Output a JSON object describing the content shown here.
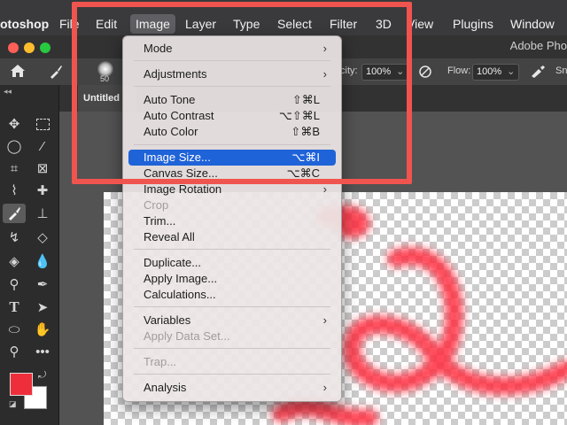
{
  "menubar": {
    "app_name": "otoshop",
    "items": [
      "File",
      "Edit",
      "Image",
      "Layer",
      "Type",
      "Select",
      "Filter",
      "3D",
      "View",
      "Plugins",
      "Window"
    ],
    "active": "Image"
  },
  "window": {
    "title": "Adobe Pho"
  },
  "options_bar": {
    "brush_size": "50",
    "opacity_label": "city:",
    "opacity_value": "100%",
    "flow_label": "Flow:",
    "flow_value": "100%",
    "smoothing_label": "Sn"
  },
  "document_tab": {
    "label": "Untitled"
  },
  "colors": {
    "foreground": "#ee2e3a",
    "background": "#ffffff",
    "accent": "#1f63d8",
    "frame": "#f0544e"
  },
  "image_menu": {
    "mode": "Mode",
    "adjustments": "Adjustments",
    "auto_tone": {
      "label": "Auto Tone",
      "shortcut": "⇧⌘L"
    },
    "auto_contrast": {
      "label": "Auto Contrast",
      "shortcut": "⌥⇧⌘L"
    },
    "auto_color": {
      "label": "Auto Color",
      "shortcut": "⇧⌘B"
    },
    "image_size": {
      "label": "Image Size...",
      "shortcut": "⌥⌘I"
    },
    "canvas_size": {
      "label": "Canvas Size...",
      "shortcut": "⌥⌘C"
    },
    "image_rotation": "Image Rotation",
    "crop": "Crop",
    "trim": "Trim...",
    "reveal_all": "Reveal All",
    "duplicate": "Duplicate...",
    "apply_image": "Apply Image...",
    "calculations": "Calculations...",
    "variables": "Variables",
    "apply_data_set": "Apply Data Set...",
    "trap": "Trap...",
    "analysis": "Analysis"
  }
}
